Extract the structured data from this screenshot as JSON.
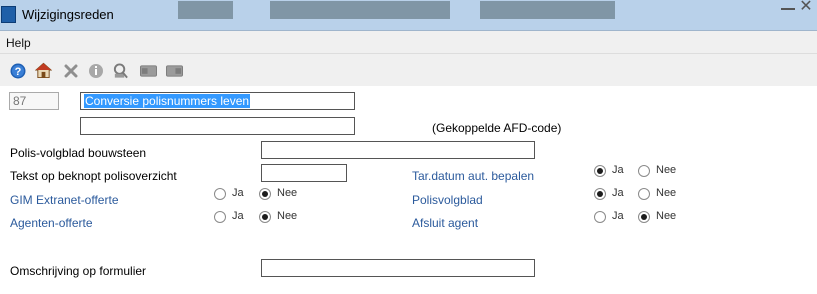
{
  "window": {
    "title": "Wijzigingsreden",
    "close_glyph": "✕"
  },
  "menu": {
    "help": "Help"
  },
  "toolbar": {
    "icons": [
      "help-icon",
      "home-icon",
      "delete-icon",
      "info-icon",
      "search-icon",
      "card-icon",
      "card-icon"
    ],
    "colors": {
      "help": "#1e5fb3",
      "home_roof": "#c23b22",
      "disabled": "#9a9a9a"
    }
  },
  "form": {
    "code": "87",
    "description": "Conversie polisnummers leven",
    "afd_code_value": "",
    "afd_code_label": "(Gekoppelde AFD-code)",
    "polis_volgblad_bouwsteen": {
      "label": "Polis-volgblad bouwsteen",
      "value": ""
    },
    "tekst_beknopt": {
      "label": "Tekst op beknopt polisoverzicht",
      "value": ""
    },
    "gim_extranet": {
      "label": "GIM Extranet-offerte",
      "ja": "Ja",
      "nee": "Nee",
      "selected": "nee"
    },
    "agenten_offerte": {
      "label": "Agenten-offerte",
      "ja": "Ja",
      "nee": "Nee",
      "selected": "nee"
    },
    "tar_datum": {
      "label": "Tar.datum aut. bepalen",
      "ja": "Ja",
      "nee": "Nee",
      "selected": "ja"
    },
    "polisvolgblad": {
      "label": "Polisvolgblad",
      "ja": "Ja",
      "nee": "Nee",
      "selected": "ja"
    },
    "afsluit_agent": {
      "label": "Afsluit agent",
      "ja": "Ja",
      "nee": "Nee",
      "selected": "nee"
    },
    "omschrijving_formulier": {
      "label": "Omschrijving op formulier",
      "value": ""
    }
  },
  "colors": {
    "label_blue": "#2b5a9c",
    "selection": "#3399ff",
    "titlebar": "#b9d1ea"
  }
}
